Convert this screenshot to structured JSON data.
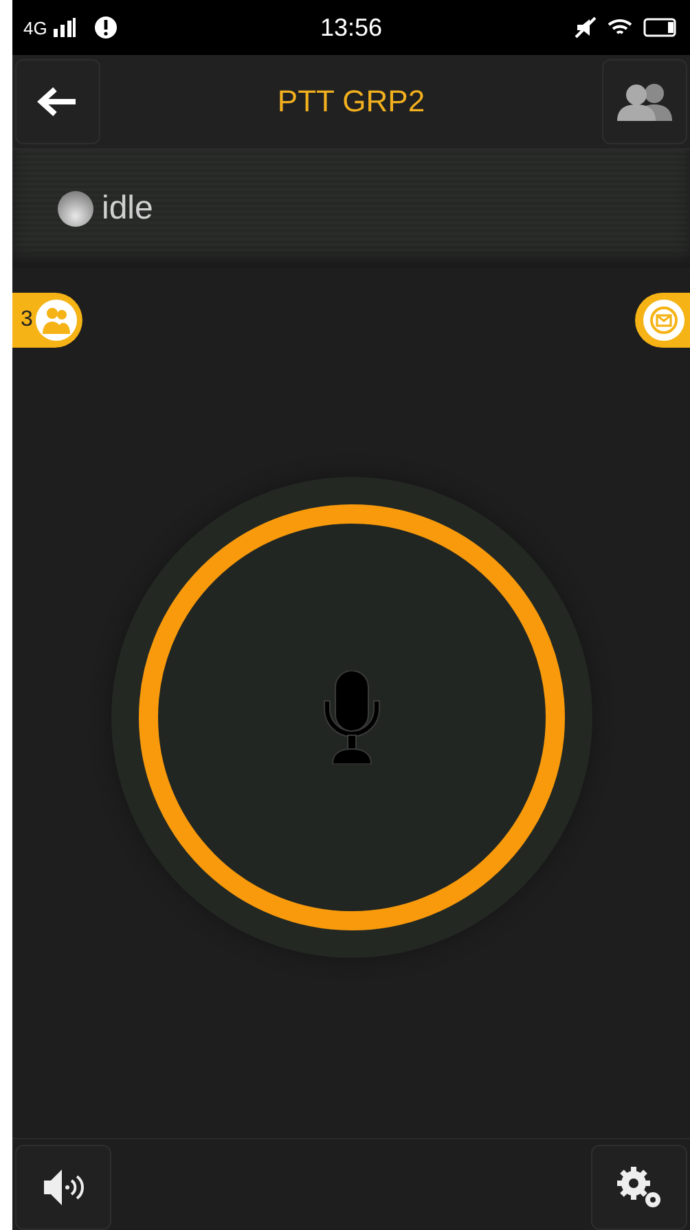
{
  "status_bar": {
    "network": "4G",
    "time": "13:56"
  },
  "header": {
    "title": "PTT GRP2"
  },
  "call_state": {
    "label": "idle",
    "active": false
  },
  "members_badge": {
    "count": "3"
  },
  "talk_button": {
    "pressed": false
  }
}
